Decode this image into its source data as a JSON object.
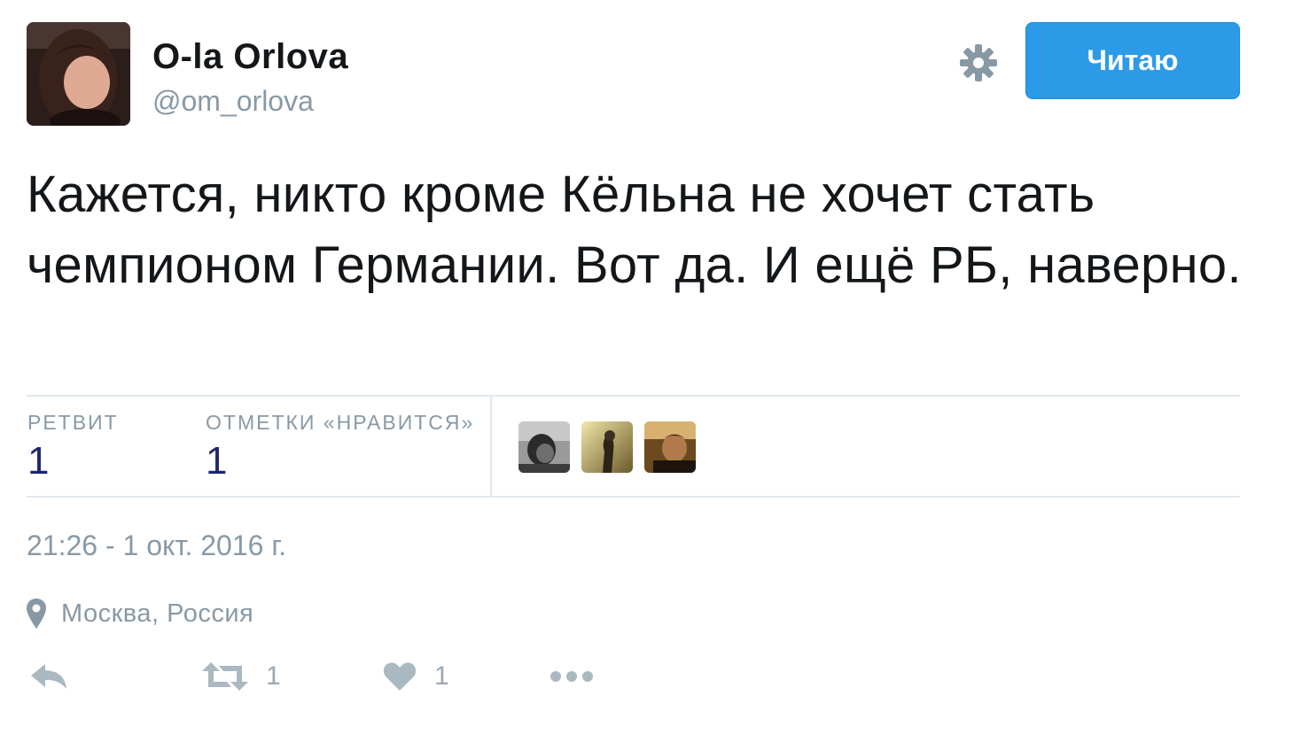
{
  "author": {
    "display_name": "O-la Orlova",
    "handle": "@om_orlova"
  },
  "header": {
    "follow_button_label": "Читаю"
  },
  "tweet": {
    "text": "Кажется, никто кроме Кёльна не хочет стать чемпионом Германии. Вот да. И ещё РБ, наверно.",
    "timestamp": "21:26 - 1 окт. 2016 г.",
    "location": "Москва, Россия"
  },
  "stats": {
    "retweets_label": "РЕТВИТ",
    "retweets_value": "1",
    "likes_label": "ОТМЕТКИ «НРАВИТСЯ»",
    "likes_value": "1"
  },
  "actions": {
    "retweet_count": "1",
    "like_count": "1"
  },
  "colors": {
    "accent": "#2b9be8",
    "muted_text": "#8899a6",
    "stat_value": "#1c2670",
    "divider": "#e1e8ed"
  },
  "icons": [
    "gear-icon",
    "location-pin-icon",
    "reply-icon",
    "retweet-icon",
    "heart-icon",
    "more-icon"
  ]
}
